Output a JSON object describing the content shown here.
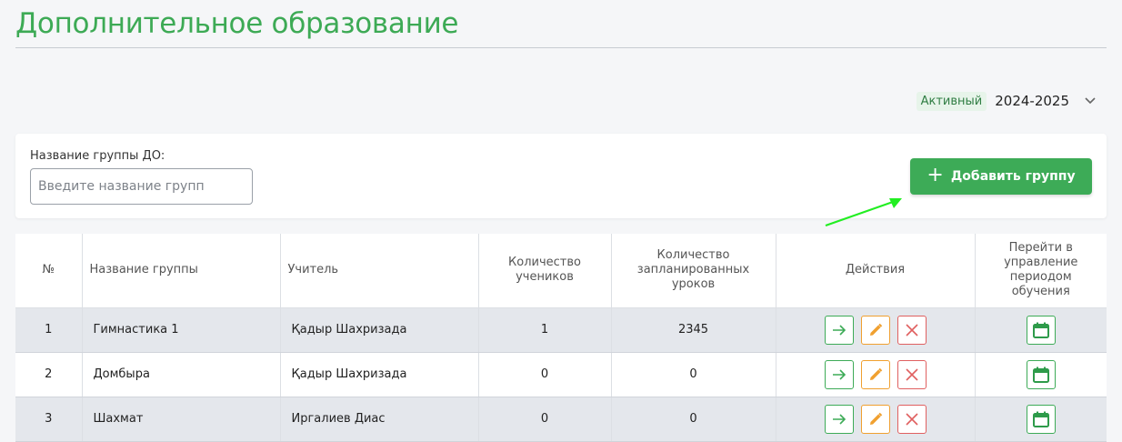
{
  "page": {
    "title": "Дополнительное образование"
  },
  "period": {
    "status": "Активный",
    "value": "2024-2025",
    "icon": "chevron-down-icon"
  },
  "filter": {
    "label": "Название группы ДО:",
    "placeholder": "Введите название групп",
    "value": ""
  },
  "add_button": {
    "label": "Добавить группу",
    "icon": "plus-icon"
  },
  "colors": {
    "accent": "#3dab57",
    "title": "#3daa55",
    "edit": "#f0a030",
    "delete": "#e06060",
    "row_shade": "#e4e7ec",
    "annotation_arrow": "#22ee22"
  },
  "table": {
    "headers": {
      "num": "№",
      "name": "Название группы",
      "teacher": "Учитель",
      "students": "Количество учеников",
      "lessons": "Количество запланированных уроков",
      "actions": "Действия",
      "period": "Перейти в управление периодом обучения"
    },
    "rows": [
      {
        "num": "1",
        "name": "Гимнастика 1",
        "teacher": "Қадыр Шахризада",
        "students": "1",
        "lessons": "2345"
      },
      {
        "num": "2",
        "name": "Домбыра",
        "teacher": "Қадыр Шахризада",
        "students": "0",
        "lessons": "0"
      },
      {
        "num": "3",
        "name": "Шахмат",
        "teacher": "Иргалиев Диас",
        "students": "0",
        "lessons": "0"
      }
    ]
  }
}
